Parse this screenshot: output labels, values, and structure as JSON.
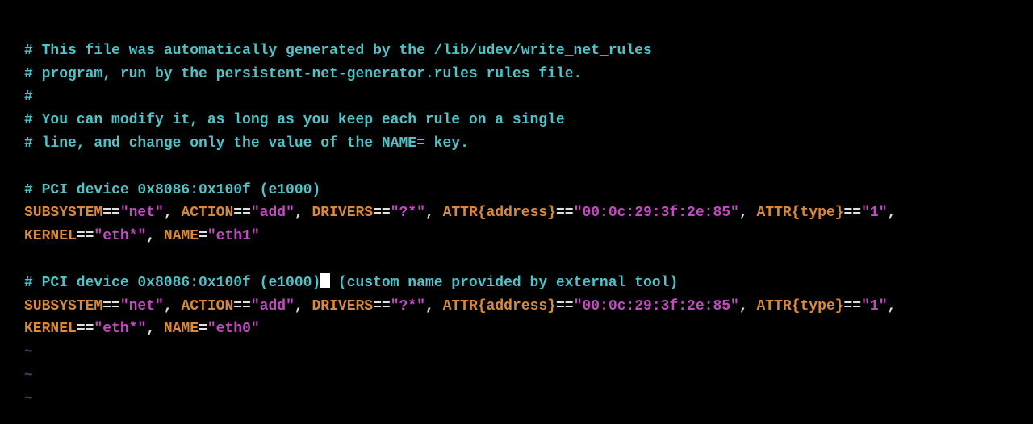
{
  "comments": {
    "l1": "# This file was automatically generated by the /lib/udev/write_net_rules",
    "l2": "# program, run by the persistent-net-generator.rules rules file.",
    "l3": "#",
    "l4": "# You can modify it, as long as you keep each rule on a single",
    "l5": "# line, and change only the value of the NAME= key.",
    "pci1": "# PCI device 0x8086:0x100f (e1000)",
    "pci2_a": "# PCI device 0x8086:0x100f (e1000)",
    "pci2_b": " (custom name provided by external tool)"
  },
  "rule1": {
    "subsystem_k": "SUBSYSTEM",
    "subsystem_v": "\"net\"",
    "action_k": "ACTION",
    "action_v": "\"add\"",
    "drivers_k": "DRIVERS",
    "drivers_v": "\"?*\"",
    "attr_addr_k": "ATTR{address}",
    "attr_addr_v": "\"00:0c:29:3f:2e:85\"",
    "attr_type_k": "ATTR{type}",
    "attr_type_v": "\"1\"",
    "kernel_k": "KERNEL",
    "kernel_v": "\"eth*\"",
    "name_k": "NAME",
    "name_v": "\"eth1\""
  },
  "rule2": {
    "subsystem_k": "SUBSYSTEM",
    "subsystem_v": "\"net\"",
    "action_k": "ACTION",
    "action_v": "\"add\"",
    "drivers_k": "DRIVERS",
    "drivers_v": "\"?*\"",
    "attr_addr_k": "ATTR{address}",
    "attr_addr_v": "\"00:0c:29:3f:2e:85\"",
    "attr_type_k": "ATTR{type}",
    "attr_type_v": "\"1\"",
    "kernel_k": "KERNEL",
    "kernel_v": "\"eth*\"",
    "name_k": "NAME",
    "name_v": "\"eth0\""
  },
  "tildes": {
    "t1": "~",
    "t2": "~",
    "t3": "~"
  },
  "op_eqeq": "==",
  "op_eq": "=",
  "comma": ", "
}
